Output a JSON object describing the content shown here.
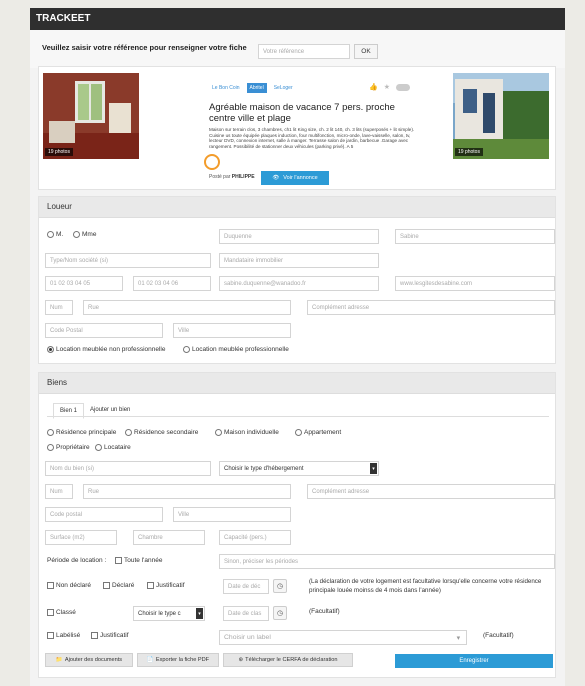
{
  "app": {
    "title": "TRACKEET"
  },
  "reference": {
    "label": "Veuillez saisir votre référence pour renseigner votre fiche",
    "placeholder": "Votre référence",
    "ok_label": "OK"
  },
  "listing": {
    "photos_left": "19 photos",
    "photos_right": "19 photos",
    "sources": [
      "Le Bon Coin",
      "Abritel",
      "SeLoger"
    ],
    "title": "Agréable maison de vacance 7 pers. proche centre ville et plage",
    "description": "Maison sur terrain clos, 3 chambres, ch1 lit King size, ch. 2 lit 140, ch. 3 lits (superposés + lit simple). Cuisine us toute équipée plaques induction, four multifonction, micro-onde, lave-vaisselle, salon, tv, lecteur DVD, connexion internet, salle à manger. Terrasse salon de jardin, barbecue .Garage avec rangement. Possibilité de stationner deux véhicules (parking privé). A 5",
    "posted_by_label": "Posté par",
    "posted_by_name": "PHILIPPE",
    "view_label": "Voir l'annonce"
  },
  "loueur": {
    "header": "Loueur",
    "civ_m": "M.",
    "civ_mme": "Mme",
    "nom": "Duquenne",
    "prenom": "Sabine",
    "type_placeholder": "Type/Nom société (si)",
    "mandataire_placeholder": "Mandataire immobilier",
    "tel1": "01 02 03 04 05",
    "tel2": "01 02 03 04 06",
    "email": "sabine.duquenne@wanadoo.fr",
    "site": "www.lesgitesdesabine.com",
    "num_placeholder": "Num",
    "rue_placeholder": "Rue",
    "complement_placeholder": "Complément adresse",
    "cp_placeholder": "Code Postal",
    "ville_placeholder": "Ville",
    "location_np": "Location meublée non professionnelle",
    "location_p": "Location meublée professionnelle"
  },
  "biens": {
    "header": "Biens",
    "tabs": [
      "Bien 1",
      "Ajouter un bien"
    ],
    "types": [
      "Résidence principale",
      "Résidence secondaire",
      "Maison individuelle",
      "Appartement"
    ],
    "owner_types": [
      "Propriétaire",
      "Locataire"
    ],
    "nom_bien_placeholder": "Nom du bien (si)",
    "hebergement_label": "Choisir le type d'hébergement",
    "num_placeholder": "Num",
    "rue_placeholder": "Rue",
    "complement_placeholder": "Complément adresse",
    "cp_placeholder": "Code postal",
    "ville_placeholder": "Ville",
    "surface_placeholder": "Surface (m2)",
    "chambre_placeholder": "Chambre",
    "capacite_placeholder": "Capacité (pers.)",
    "periode_label": "Période de location :",
    "toute_annee": "Toute l'année",
    "periode_placeholder": "Sinon, préciser les périodes",
    "non_declare": "Non déclaré",
    "declare": "Déclaré",
    "justificatif": "Justificatif",
    "date_dec_placeholder": "Date de déc",
    "declaration_note": "(La déclaration de votre logement est facultative lorsqu'elle concerne votre résidence principale louée moinss de 4 mois dans l'année)",
    "classe": "Classé",
    "classe_select": "Choisir le type c",
    "date_class_placeholder": "Date de clas",
    "facultatif": "(Facultatif)",
    "labelise": "Labélisé",
    "justificatif2": "Justificatif",
    "label_placeholder": "Choisir un label",
    "facultatif2": "(Facultatif)",
    "btn_docs": "Ajouter des documents",
    "btn_pdf": "Exporter la fiche PDF",
    "btn_cerfa": "Télécharger le CERFA de déclaration",
    "btn_save": "Enregistrer"
  }
}
